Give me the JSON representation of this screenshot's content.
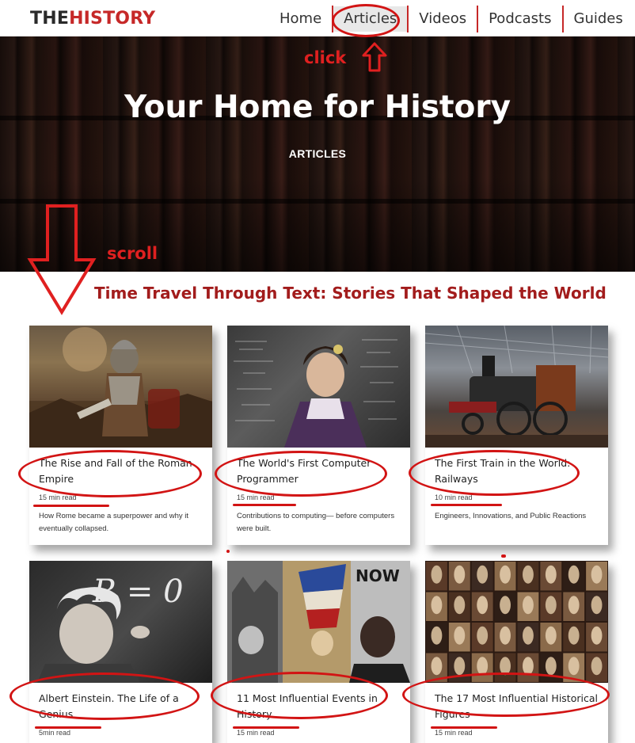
{
  "brand": {
    "part1": "THE",
    "part2": "HISTORY"
  },
  "nav": {
    "items": [
      "Home",
      "Articles",
      "Videos",
      "Podcasts",
      "Guides"
    ],
    "active": "Articles"
  },
  "hero": {
    "title": "Your Home for History",
    "subtitle": "ARTICLES"
  },
  "annotations": {
    "click": "click",
    "scroll": "scroll"
  },
  "section": {
    "title": "Time Travel Through Text: Stories That Shaped the World"
  },
  "articles": [
    {
      "title": "The Rise and Fall of the Roman Empire",
      "read_time": "15 min read",
      "description": "How Rome became a superpower and why it eventually collapsed."
    },
    {
      "title": "The World's First Computer Programmer",
      "read_time": "15 min read",
      "description": "Contributions to computing— before computers were built."
    },
    {
      "title": "The First Train in the World: Railways",
      "read_time": "10 min read",
      "description": "Engineers, Innovations, and Public Reactions"
    },
    {
      "title": "Albert Einstein. The Life of a Genius",
      "read_time": "5min read",
      "description": ""
    },
    {
      "title": "11 Most Influential Events in History",
      "read_time": "15 min read",
      "description": ""
    },
    {
      "title": "The 17 Most Influential Historical Figures",
      "read_time": "15 min read",
      "description": ""
    }
  ],
  "image_text": {
    "chalkboard": "R = 0",
    "poster": "NOW"
  },
  "colors": {
    "brand_red": "#c62828",
    "annotation_red": "#d21414",
    "section_title": "#a21c1c"
  }
}
